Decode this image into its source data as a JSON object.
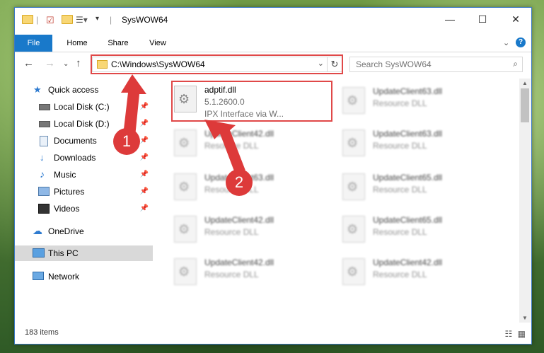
{
  "window": {
    "title": "SysWOW64",
    "minimize_icon": "minimize-icon",
    "maximize_icon": "maximize-icon",
    "close_icon": "close-icon"
  },
  "ribbon": {
    "tabs": [
      "File",
      "Home",
      "Share",
      "View"
    ],
    "expand_icon": "chevron-down-icon",
    "help_icon": "help-icon"
  },
  "address_bar": {
    "path": "C:\\Windows\\SysWOW64",
    "refresh_icon": "refresh-icon"
  },
  "search": {
    "placeholder": "Search SysWOW64"
  },
  "sidebar": {
    "items": [
      {
        "label": "Quick access",
        "icon": "star-icon"
      },
      {
        "label": "Local Disk (C:)",
        "icon": "drive-icon",
        "pinned": true
      },
      {
        "label": "Local Disk (D:)",
        "icon": "drive-icon",
        "pinned": true
      },
      {
        "label": "Documents",
        "icon": "documents-icon",
        "pinned": true
      },
      {
        "label": "Downloads",
        "icon": "download-icon",
        "pinned": true
      },
      {
        "label": "Music",
        "icon": "music-icon",
        "pinned": true
      },
      {
        "label": "Pictures",
        "icon": "pictures-icon",
        "pinned": true
      },
      {
        "label": "Videos",
        "icon": "videos-icon",
        "pinned": true
      },
      {
        "label": "OneDrive",
        "icon": "cloud-icon"
      },
      {
        "label": "This PC",
        "icon": "computer-icon",
        "selected": true
      },
      {
        "label": "Network",
        "icon": "network-icon"
      }
    ]
  },
  "files": [
    {
      "name": "adptif.dll",
      "line2": "5.1.2600.0",
      "line3": "IPX Interface via W..."
    },
    {
      "name": "UpdateClient63.dll",
      "line2": "Resource DLL"
    },
    {
      "name": "UpdateClient42.dll",
      "line2": "Resource DLL"
    },
    {
      "name": "UpdateClient63.dll",
      "line2": "Resource DLL"
    },
    {
      "name": "UpdateClient63.dll",
      "line2": "Resource DLL"
    },
    {
      "name": "UpdateClient65.dll",
      "line2": "Resource DLL"
    },
    {
      "name": "UpdateClient42.dll",
      "line2": "Resource DLL"
    },
    {
      "name": "UpdateClient65.dll",
      "line2": "Resource DLL"
    },
    {
      "name": "UpdateClient42.dll",
      "line2": "Resource DLL"
    },
    {
      "name": "UpdateClient42.dll",
      "line2": "Resource DLL"
    }
  ],
  "status": {
    "item_count": "183 items"
  },
  "annotations": {
    "step1": "1",
    "step2": "2",
    "color": "#dd3a3a"
  }
}
